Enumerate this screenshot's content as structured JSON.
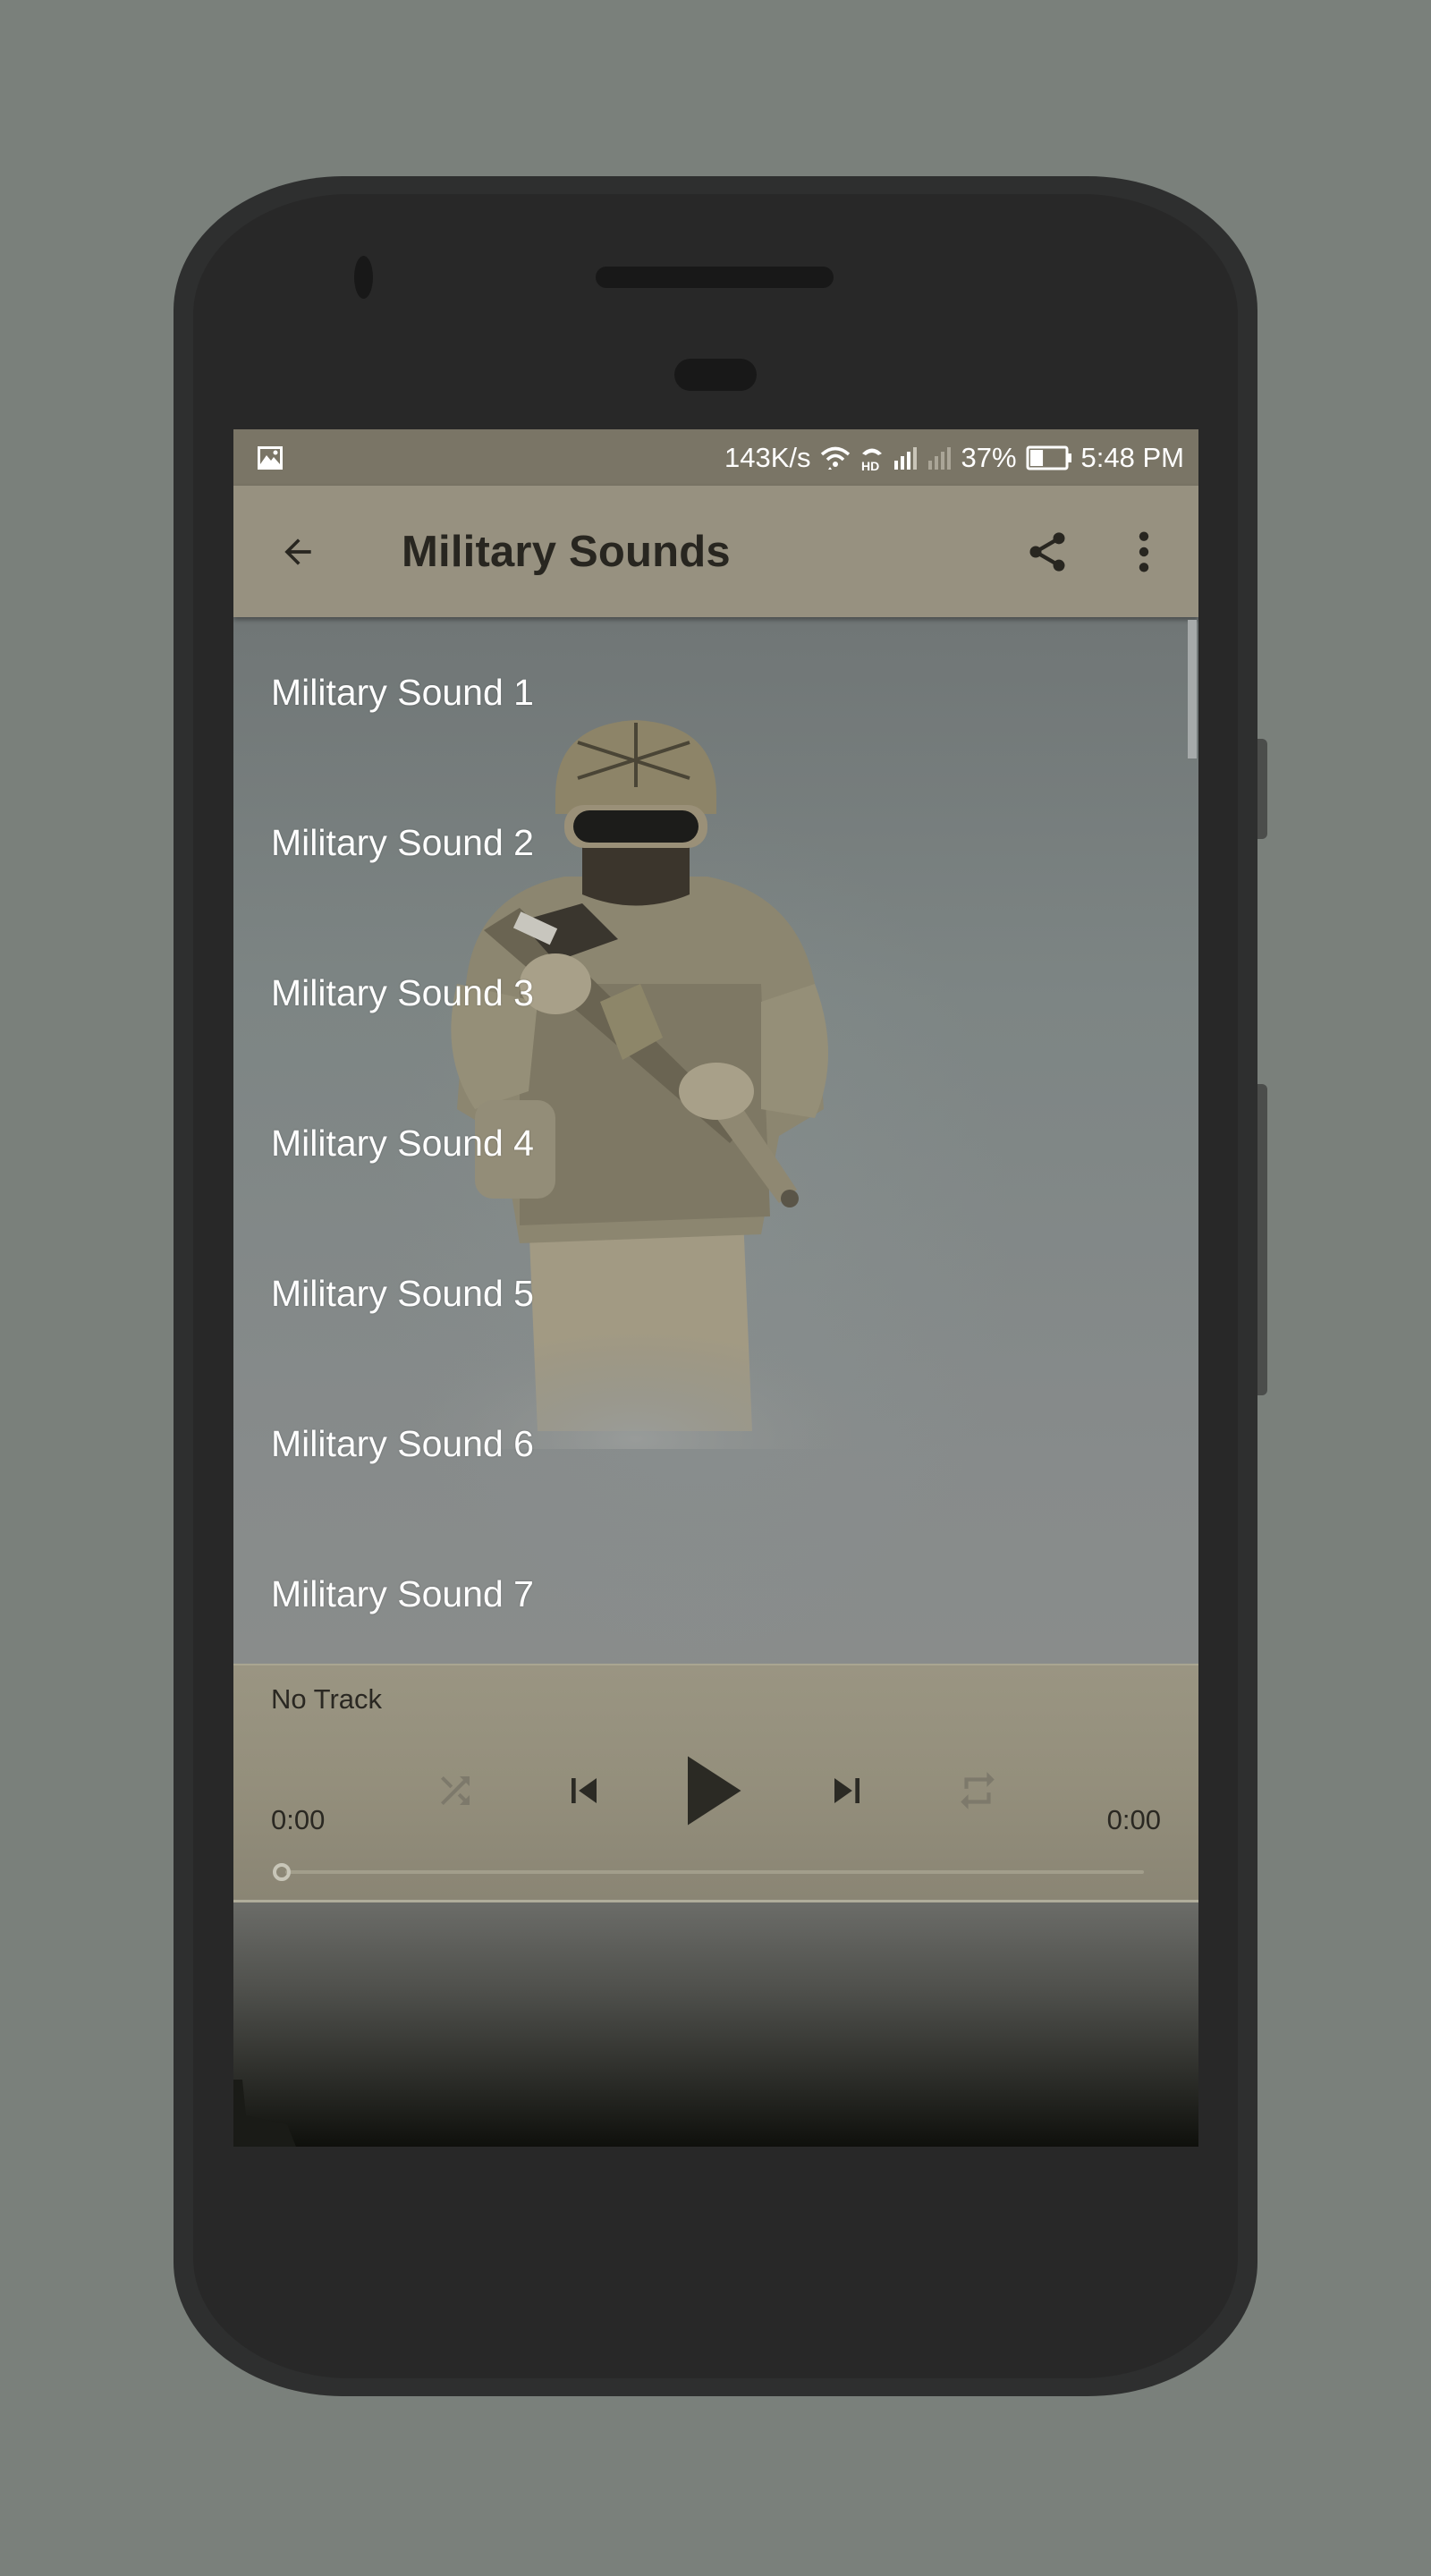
{
  "status_bar": {
    "notification_icon": "gallery-icon",
    "network_speed": "143K/s",
    "wifi_icon": "wifi-icon",
    "hd_icon": "hd-call-icon",
    "signal_1_icon": "signal-bars-icon",
    "signal_2_icon": "signal-no-service-icon",
    "battery_percent": "37%",
    "battery_level": 0.37,
    "battery_icon": "battery-icon",
    "time": "5:48 PM"
  },
  "app_bar": {
    "back_icon": "arrow-back-icon",
    "title": "Military Sounds",
    "share_icon": "share-icon",
    "more_icon": "more-vert-icon"
  },
  "sound_list": {
    "items": [
      {
        "label": "Military Sound 1"
      },
      {
        "label": "Military Sound 2"
      },
      {
        "label": "Military Sound 3"
      },
      {
        "label": "Military Sound 4"
      },
      {
        "label": "Military Sound 5"
      },
      {
        "label": "Military Sound 6"
      },
      {
        "label": "Military Sound 7"
      }
    ]
  },
  "player": {
    "track_name": "No Track",
    "time_elapsed": "0:00",
    "time_total": "0:00",
    "progress": 0,
    "controls": {
      "shuffle": {
        "icon": "shuffle-icon",
        "enabled": false
      },
      "previous": {
        "icon": "skip-previous-icon",
        "enabled": true
      },
      "play": {
        "icon": "play-icon",
        "enabled": true
      },
      "next": {
        "icon": "skip-next-icon",
        "enabled": true
      },
      "repeat": {
        "icon": "repeat-icon",
        "enabled": false
      }
    }
  },
  "colors": {
    "status_bar_bg": "#7a7566",
    "app_bar_bg": "#979180",
    "player_bg": "#948f7c",
    "text_dark": "#282620",
    "list_text": "#ffffff",
    "disabled_icon": "#7d796b",
    "device_body": "#282828",
    "page_bg": "#7a807b"
  }
}
